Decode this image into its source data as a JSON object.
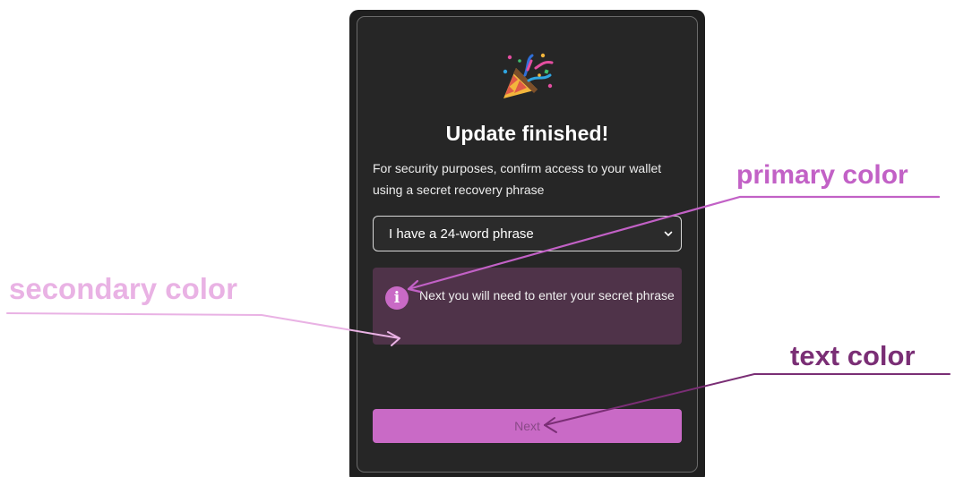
{
  "dialog": {
    "title": "Update finished!",
    "subtitle": "For security purposes, confirm access to your wallet using a secret recovery phrase",
    "phrase_select": {
      "selected": "I have a 24-word phrase"
    },
    "notice": {
      "text": "Next you will need to enter your secret phrase"
    },
    "next_label": "Next",
    "icons": {
      "hero": "party-popper-icon",
      "info": "info-icon",
      "select": "chevron-down-icon"
    }
  },
  "annotations": {
    "primary": {
      "label": "primary color",
      "color": "#c261c6"
    },
    "secondary": {
      "label": "secondary color",
      "color": "#e9b2e4"
    },
    "text": {
      "label": "text color",
      "color": "#7a2e75"
    }
  },
  "colors": {
    "primary": "#c96ac6",
    "secondary": "#4f3349",
    "text_on_primary": "#8a4a88",
    "card_background": "#262626"
  }
}
